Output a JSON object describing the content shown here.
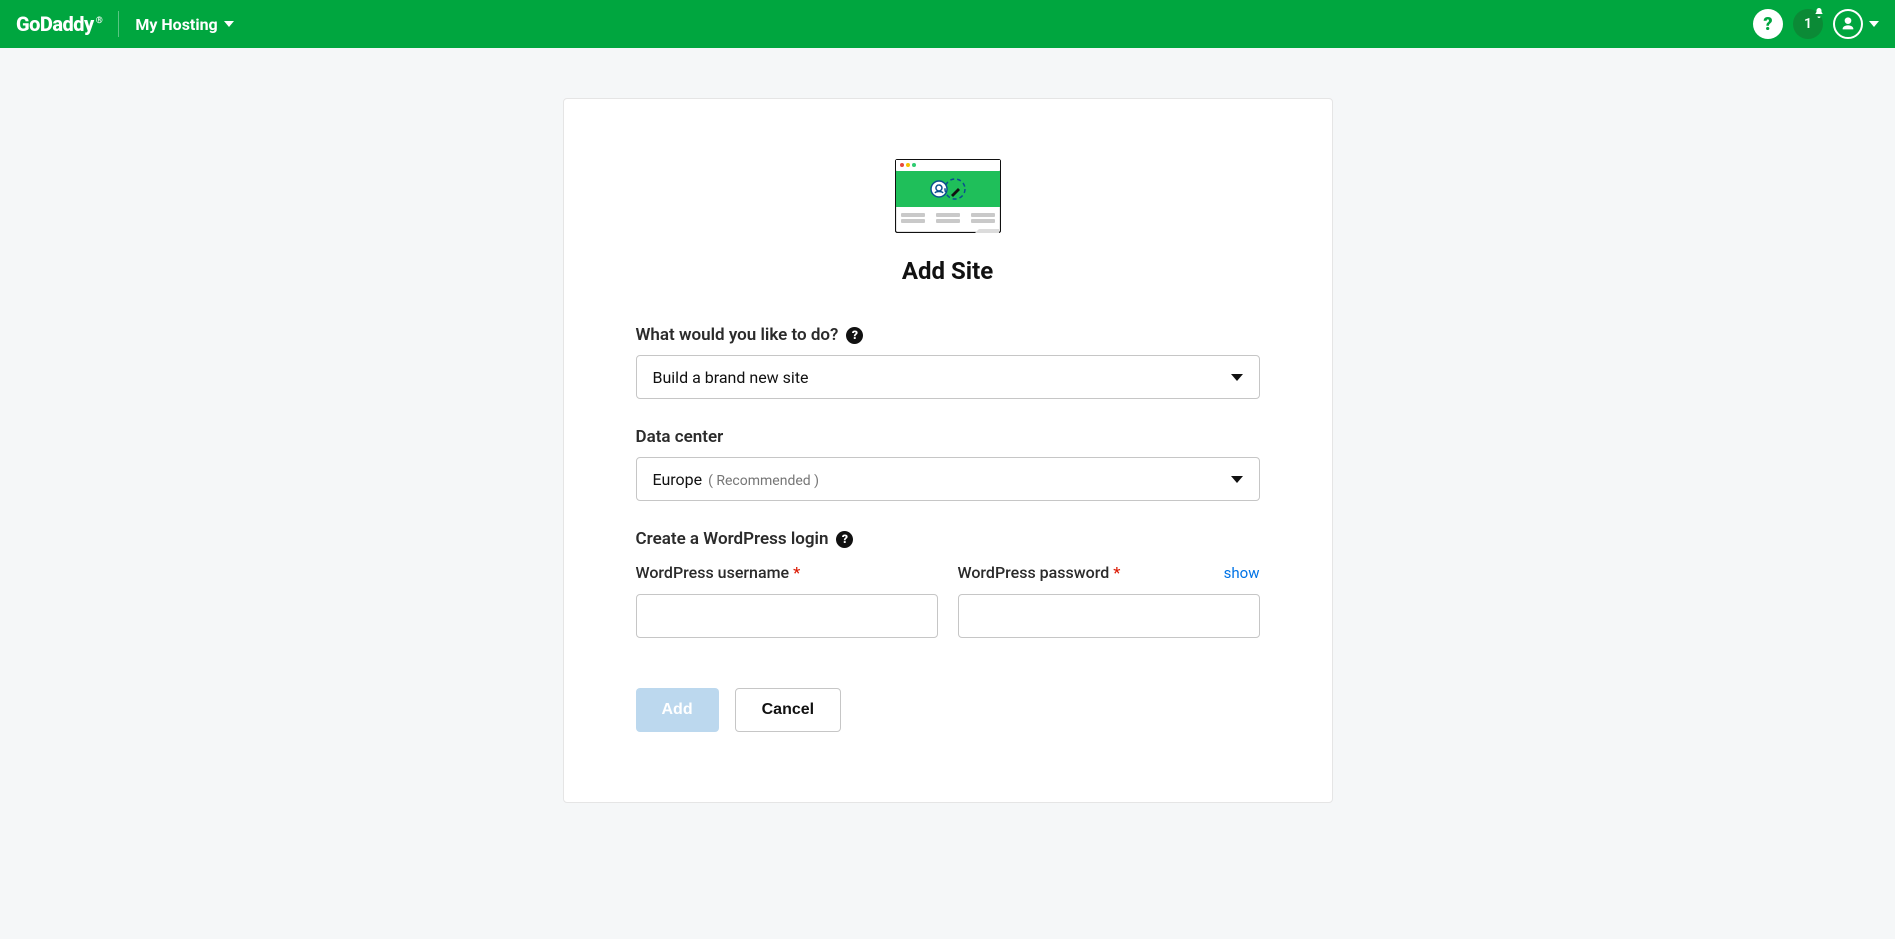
{
  "topbar": {
    "logo_text": "GoDaddy",
    "logo_reg": "®",
    "nav_label": "My Hosting",
    "notification_count": "1"
  },
  "page": {
    "title": "Add Site"
  },
  "form": {
    "action_label": "What would you like to do?",
    "action_value": "Build a brand new site",
    "datacenter_label": "Data center",
    "datacenter_value": "Europe",
    "datacenter_extra": "( Recommended )",
    "login_section_label": "Create a WordPress login",
    "username_label": "WordPress username",
    "password_label": "WordPress password",
    "required_marker": "*",
    "show_link": "show",
    "username_value": "",
    "password_value": ""
  },
  "buttons": {
    "add": "Add",
    "cancel": "Cancel"
  }
}
